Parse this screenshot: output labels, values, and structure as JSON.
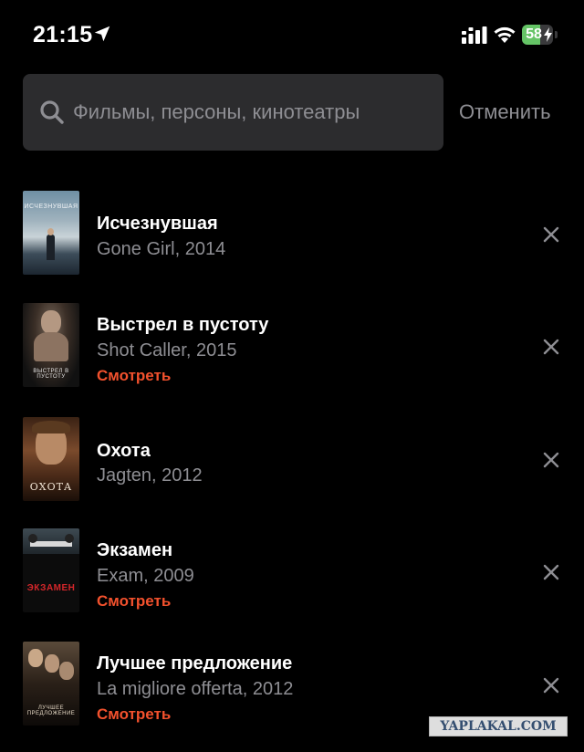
{
  "status_bar": {
    "time": "21:15",
    "battery_percent": "58",
    "battery_level": 0.58,
    "battery_color": "#65c466",
    "icons": [
      "location-arrow-icon",
      "cellular-signal-icon",
      "wifi-icon",
      "battery-charging-icon"
    ]
  },
  "search": {
    "placeholder": "Фильмы, персоны, кинотеатры",
    "value": "",
    "cancel_label": "Отменить"
  },
  "colors": {
    "background": "#000000",
    "search_field": "#2c2c2e",
    "secondary_text": "#8e8e93",
    "accent": "#f2512d"
  },
  "history": [
    {
      "title": "Исчезнувшая",
      "subtitle": "Gone Girl, 2014",
      "watch_label": "",
      "poster_text": "ИСЧЕЗНУВШАЯ"
    },
    {
      "title": "Выстрел в пустоту",
      "subtitle": "Shot Caller, 2015",
      "watch_label": "Смотреть",
      "poster_text": "ВЫСТРЕЛ В ПУСТОТУ"
    },
    {
      "title": "Охота",
      "subtitle": "Jagten, 2012",
      "watch_label": "",
      "poster_text": "ОХОТА"
    },
    {
      "title": "Экзамен",
      "subtitle": "Exam, 2009",
      "watch_label": "Смотреть",
      "poster_text": "ЭКЗАМЕН"
    },
    {
      "title": "Лучшее предложение",
      "subtitle": "La migliore offerta, 2012",
      "watch_label": "Смотреть",
      "poster_text": "ЛУЧШЕЕ ПРЕДЛОЖЕНИЕ"
    }
  ],
  "watermark": "YAPLAKAL.COM"
}
